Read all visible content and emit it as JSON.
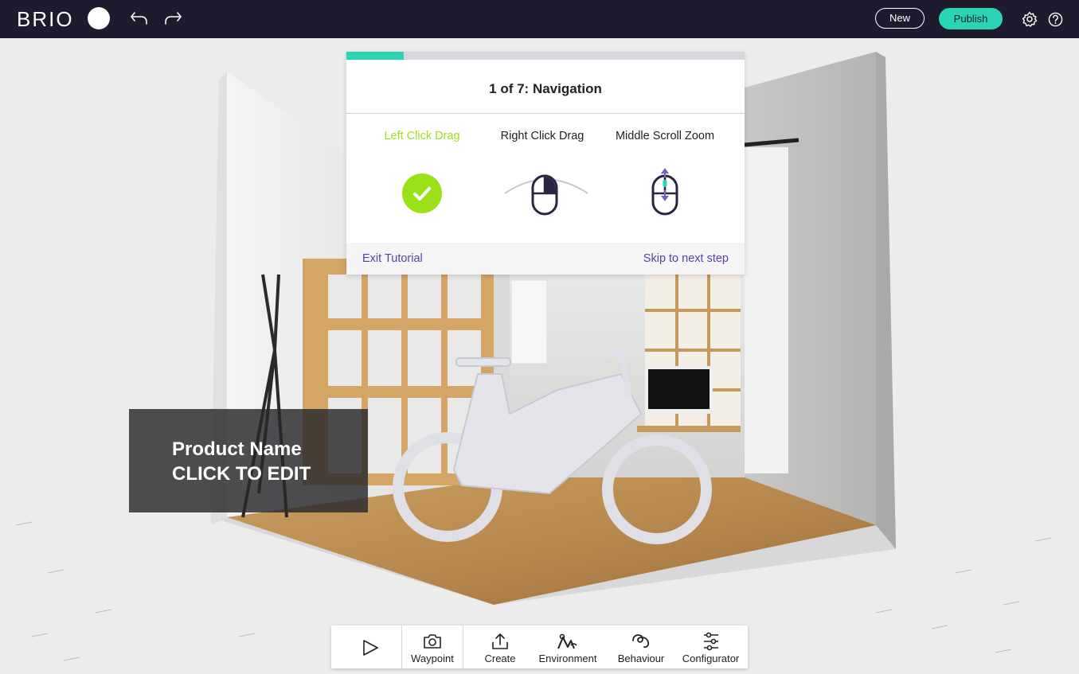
{
  "app": {
    "logo": "BRIO",
    "new_label": "New",
    "publish_label": "Publish",
    "accent_color": "#2ad5b6",
    "topbar_color": "#1e1b2e"
  },
  "icons": {
    "undo": "undo-icon",
    "redo": "redo-icon",
    "settings": "gear-icon",
    "help": "help-icon"
  },
  "product": {
    "name": "Product Name",
    "edit_hint": "CLICK TO EDIT"
  },
  "tutorial": {
    "title": "1 of 7: Navigation",
    "progress": 0.143,
    "steps": [
      {
        "label": "Left Click Drag",
        "icon": "check-circle-icon",
        "completed": true
      },
      {
        "label": "Right Click Drag",
        "icon": "mouse-right-click-icon",
        "completed": false
      },
      {
        "label": "Middle Scroll Zoom",
        "icon": "mouse-scroll-icon",
        "completed": false
      }
    ],
    "exit_label": "Exit Tutorial",
    "skip_label": "Skip to next step",
    "active_color": "#9be11a",
    "link_color": "#5a3fa6"
  },
  "toolbar": {
    "items": [
      {
        "label": "",
        "icon": "play-icon"
      },
      {
        "label": "Waypoint",
        "icon": "camera-icon"
      },
      {
        "label": "Create",
        "icon": "upload-icon"
      },
      {
        "label": "Environment",
        "icon": "environment-icon"
      },
      {
        "label": "Behaviour",
        "icon": "behaviour-icon"
      },
      {
        "label": "Configurator",
        "icon": "sliders-icon"
      }
    ]
  }
}
